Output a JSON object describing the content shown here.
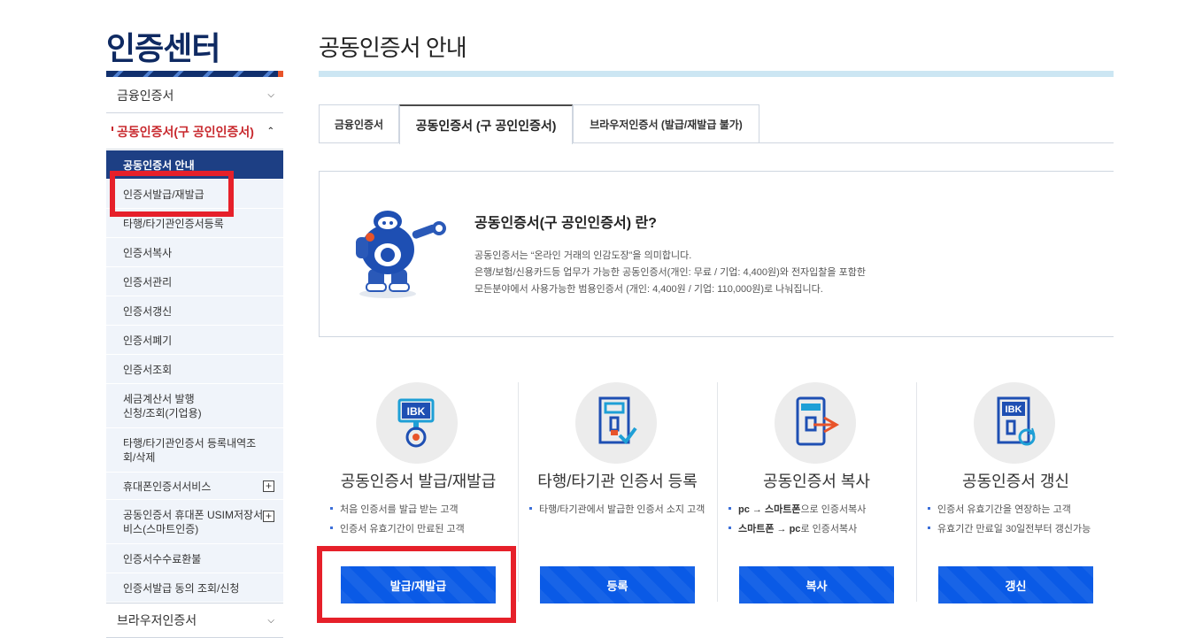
{
  "sidebar": {
    "title": "인증센터",
    "menus": [
      {
        "label": "금융인증서",
        "chevron": "chevron-down"
      },
      {
        "label": "공동인증서(구 공인인증서)",
        "chevron": "chevron-up"
      },
      {
        "label": "브라우저인증서",
        "chevron": "chevron-down"
      }
    ],
    "submenu": [
      {
        "label": "공동인증서 안내"
      },
      {
        "label": "인증서발급/재발급"
      },
      {
        "label": "타행/타기관인증서등록"
      },
      {
        "label": "인증서복사"
      },
      {
        "label": "인증서관리"
      },
      {
        "label": "인증서갱신"
      },
      {
        "label": "인증서폐기"
      },
      {
        "label": "인증서조회"
      },
      {
        "label": "세금계산서 발행\n신청/조회(기업용)"
      },
      {
        "label": "타행/타기관인증서 등록내역조\n회/삭제"
      },
      {
        "label": "휴대폰인증서서비스"
      },
      {
        "label": "공동인증서 휴대폰 USIM저장서\n비스(스마트인증)"
      },
      {
        "label": "인증서수수료환불"
      },
      {
        "label": "인증서발급 동의 조회/신청"
      }
    ]
  },
  "main": {
    "page_title": "공동인증서 안내",
    "tabs": [
      {
        "label": "금융인증서"
      },
      {
        "label": "공동인증서 (구 공인인증서)"
      },
      {
        "label": "브라우저인증서 (발급/재발급 불가)"
      }
    ],
    "info": {
      "heading": "공동인증서(구 공인인증서) 란?",
      "lines": [
        "공동인증서는 “온라인 거래의 인감도장”을 의미합니다.",
        "은행/보험/신용카드등 업무가 가능한 공동인증서(개인: 무료 / 기업: 4,400원)와 전자입찰을 포함한",
        "모든분야에서 사용가능한 범용인증서 (개인: 4,400원 / 기업: 110,000원)로 나눠집니다."
      ]
    },
    "cards": [
      {
        "title": "공동인증서 발급/재발급",
        "icon": "ibk-certificate-icon",
        "bullets": [
          "처음 인증서를 발급 받는 고객",
          "인증서 유효기간이 만료된 고객"
        ],
        "button": "발급/재발급"
      },
      {
        "title": "타행/타기관 인증서 등록",
        "icon": "register-certificate-icon",
        "bullets": [
          "타행/타기관에서 발급한 인증서 소지 고객"
        ],
        "button": "등록"
      },
      {
        "title": "공동인증서 복사",
        "icon": "copy-certificate-icon",
        "bullets_rich": [
          {
            "a": "pc → 스마트폰",
            "b": "으로 인증서복사"
          },
          {
            "a": "스마트폰 → pc",
            "b": "로 인증서복사"
          }
        ],
        "button": "복사"
      },
      {
        "title": "공동인증서 갱신",
        "icon": "renew-certificate-icon",
        "bullets": [
          "인증서 유효기간을 연장하는 고객",
          "유효기간 만료일 30일전부터 갱신가능"
        ],
        "button": "갱신"
      }
    ],
    "icon_text": "IBK"
  },
  "colors": {
    "brand_navy": "#1d3f84",
    "active_red": "#c8292e",
    "button_blue": "#0a5ae6",
    "highlight_red": "#e6202a",
    "title_bar": "#cce6f3"
  }
}
